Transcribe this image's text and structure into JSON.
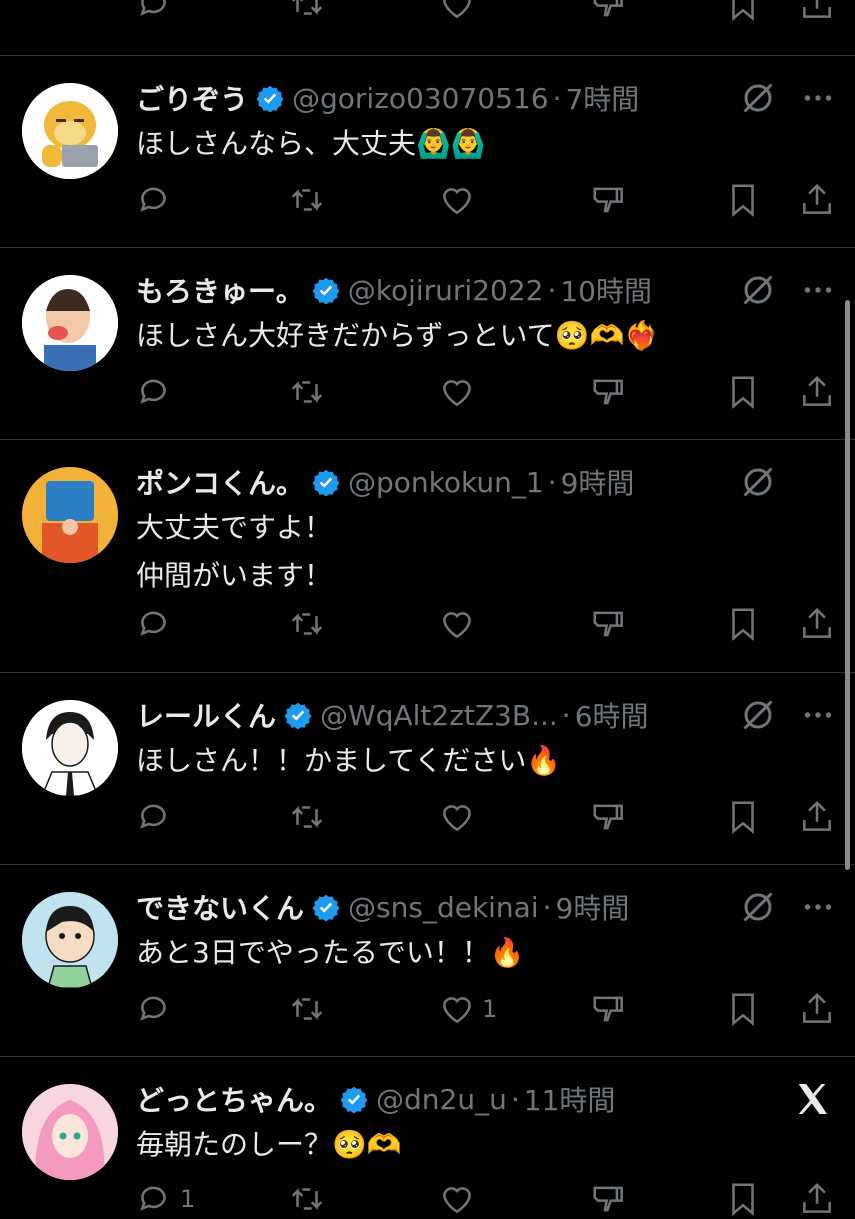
{
  "tweets": [
    {
      "name": "ごりぞう",
      "handle": "@gorizo03070516",
      "time": "7時間",
      "text": [
        "ほしさんなら、大丈夫🙆‍♂️🙆‍♂️"
      ],
      "like_count": ""
    },
    {
      "name": "もろきゅー。",
      "handle": "@kojiruri2022",
      "time": "10時間",
      "text": [
        "ほしさん大好きだからずっといて🥺🫶❤️‍🔥"
      ],
      "like_count": ""
    },
    {
      "name": "ポンコくん。",
      "handle": "@ponkokun_1",
      "time": "9時間",
      "text": [
        "大丈夫ですよ！",
        "仲間がいます！"
      ],
      "like_count": ""
    },
    {
      "name": "レールくん",
      "handle": "@WqAlt2ztZ3B...",
      "time": "6時間",
      "text": [
        "ほしさん！！かましてください🔥"
      ],
      "like_count": ""
    },
    {
      "name": "できないくん",
      "handle": "@sns_dekinai",
      "time": "9時間",
      "text": [
        "あと3日でやったるでい！！🔥"
      ],
      "like_count": "1"
    },
    {
      "name": "どっとちゃん。",
      "handle": "@dn2u_u",
      "time": "11時間",
      "text": [
        "毎朝たのしー？🥺🫶"
      ],
      "reply_count": "1"
    }
  ],
  "separator": "·",
  "colors": {
    "background": "#000000",
    "text": "#e7e9ea",
    "muted": "#71767b",
    "verified": "#1d9bf0",
    "divider": "#2f3336"
  },
  "icons": [
    "reply-icon",
    "retweet-icon",
    "like-icon",
    "dislike-icon",
    "bookmark-icon",
    "share-icon",
    "grok-icon",
    "more-icon",
    "verified-badge-icon",
    "x-logo-icon"
  ]
}
